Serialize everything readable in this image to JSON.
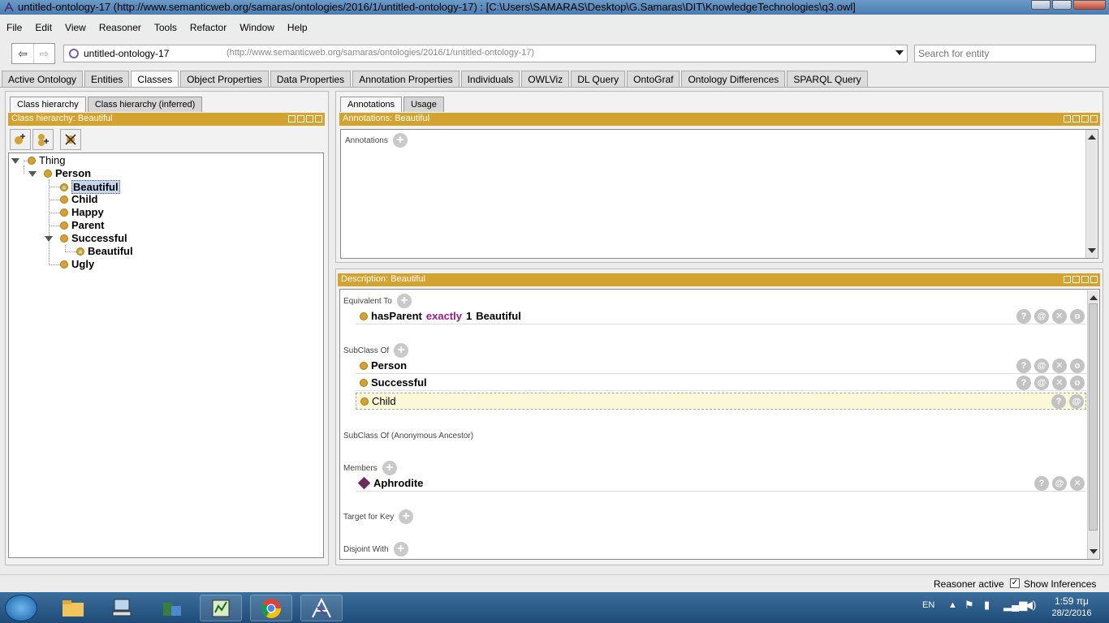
{
  "window": {
    "title": "untitled-ontology-17 (http://www.semanticweb.org/samaras/ontologies/2016/1/untitled-ontology-17)  : [C:\\Users\\SAMARAS\\Desktop\\G.Samaras\\DIT\\KnowledgeTechnologies\\q3.owl]"
  },
  "menu": [
    "File",
    "Edit",
    "View",
    "Reasoner",
    "Tools",
    "Refactor",
    "Window",
    "Help"
  ],
  "toolbar": {
    "ontology_name": "untitled-ontology-17",
    "ontology_uri": "(http://www.semanticweb.org/samaras/ontologies/2016/1/untitled-ontology-17)",
    "search_placeholder": "Search for entity"
  },
  "tabs": [
    "Active Ontology",
    "Entities",
    "Classes",
    "Object Properties",
    "Data Properties",
    "Annotation Properties",
    "Individuals",
    "OWLViz",
    "DL Query",
    "OntoGraf",
    "Ontology Differences",
    "SPARQL Query"
  ],
  "active_tab": "Classes",
  "left": {
    "subtabs": [
      "Class hierarchy",
      "Class hierarchy (inferred)"
    ],
    "header": "Class hierarchy: Beautiful",
    "tree": {
      "thing": "Thing",
      "person": "Person",
      "beautiful": "Beautiful",
      "child": "Child",
      "happy": "Happy",
      "parent": "Parent",
      "successful": "Successful",
      "successful_beautiful": "Beautiful",
      "ugly": "Ugly"
    }
  },
  "right": {
    "subtabs": [
      "Annotations",
      "Usage"
    ],
    "annotations_header": "Annotations: Beautiful",
    "annotations_label": "Annotations",
    "description_header": "Description: Beautiful",
    "sections": {
      "equivalent_to": "Equivalent To",
      "subclass_of": "SubClass Of",
      "subclass_anon": "SubClass Of (Anonymous Ancestor)",
      "members": "Members",
      "target_for_key": "Target for Key",
      "disjoint_with": "Disjoint With"
    },
    "equivalent": {
      "prop": "hasParent",
      "kw": "exactly",
      "num": "1",
      "cls": "Beautiful"
    },
    "subclasses": [
      "Person",
      "Successful",
      "Child"
    ],
    "members": [
      "Aphrodite"
    ]
  },
  "status": {
    "reasoner": "Reasoner active",
    "show_inferences": "Show Inferences"
  },
  "taskbar": {
    "lang": "EN",
    "time": "1:59 πμ",
    "date": "28/2/2016"
  },
  "colors": {
    "view_header": "#d4a22e",
    "class_dot": "#d4a22e",
    "keyword": "#a0188a",
    "individual": "#6d2d5a"
  }
}
